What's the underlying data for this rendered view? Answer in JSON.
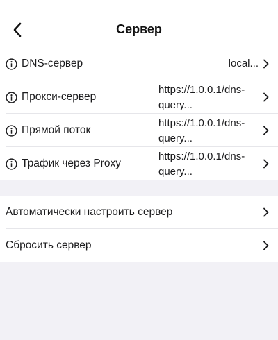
{
  "header": {
    "title": "Сервер"
  },
  "server_list": [
    {
      "label": "DNS-сервер",
      "value": "local...",
      "icon": "info-icon"
    },
    {
      "label": "Прокси-сервер",
      "value_line1": "https://1.0.0.1/dns-",
      "value_line2": "query...",
      "icon": "info-icon"
    },
    {
      "label": "Прямой поток",
      "value_line1": "https://1.0.0.1/dns-",
      "value_line2": "query...",
      "icon": "info-icon"
    },
    {
      "label": "Трафик через Proxy",
      "value_line1": "https://1.0.0.1/dns-",
      "value_line2": "query...",
      "icon": "info-icon"
    }
  ],
  "actions": [
    {
      "label": "Автоматически настроить сервер"
    },
    {
      "label": "Сбросить сервер"
    }
  ],
  "colors": {
    "background": "#f2f1f6",
    "surface": "#ffffff",
    "text": "#1c1c1e",
    "separator": "#e6e6ea"
  }
}
